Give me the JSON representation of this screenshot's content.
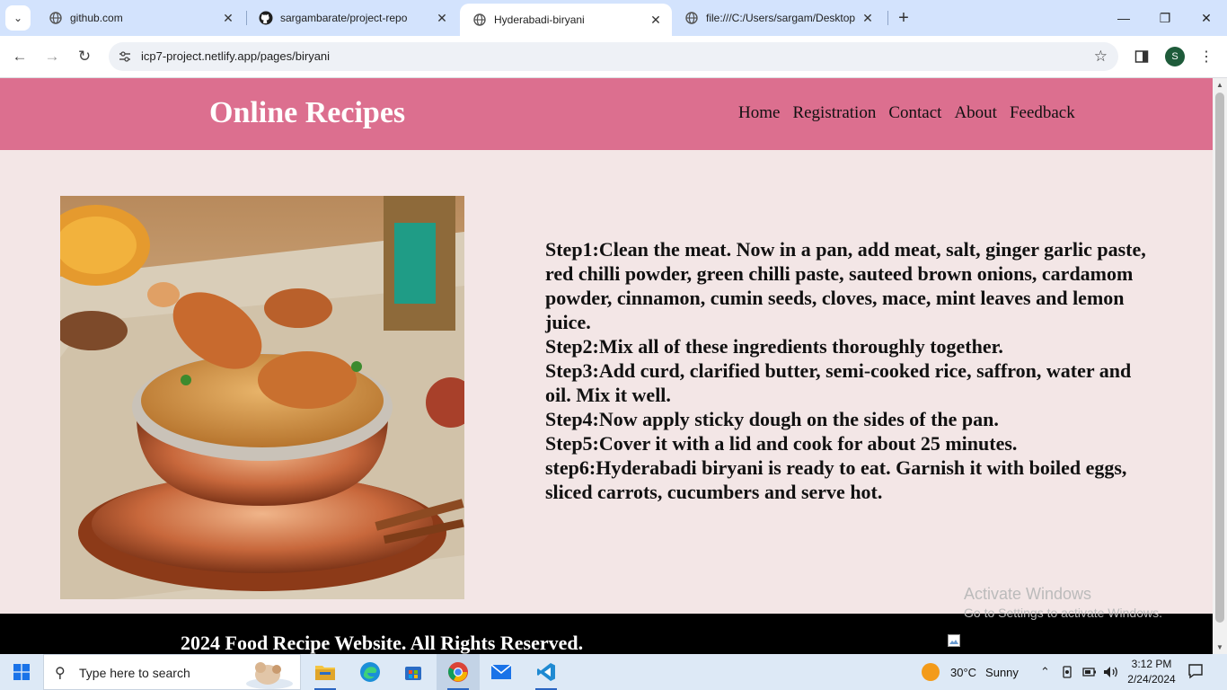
{
  "browser": {
    "tabs": [
      {
        "title": "github.com",
        "icon": "globe-icon",
        "active": false
      },
      {
        "title": "sargambarate/project-repo",
        "icon": "github-icon",
        "active": false
      },
      {
        "title": "Hyderabadi-biryani",
        "icon": "globe-icon",
        "active": true
      },
      {
        "title": "file:///C:/Users/sargam/Desktop",
        "icon": "globe-icon",
        "active": false
      }
    ],
    "url": "icp7-project.netlify.app/pages/biryani",
    "profile_initial": "S"
  },
  "page": {
    "logo": "Online Recipes",
    "nav": [
      "Home",
      "Registration",
      "Contact",
      "About",
      "Feedback"
    ],
    "steps": [
      "Step1:Clean the meat. Now in a pan, add meat, salt, ginger garlic paste,",
      "red chilli powder, green chilli paste, sauteed brown onions, cardamom powder, cinnamon, cumin seeds, cloves, mace, mint leaves and lemon juice.",
      "Step2:Mix all of these ingredients thoroughly together.",
      "Step3:Add curd, clarified butter, semi-cooked rice, saffron, water and oil. Mix it well.",
      "Step4:Now apply sticky dough on the sides of the pan.",
      "Step5:Cover it with a lid and cook for about 25 minutes.",
      "step6:Hyderabadi biryani is ready to eat. Garnish it with boiled eggs, sliced carrots, cucumbers and serve hot."
    ],
    "footer": "2024 Food Recipe Website. All Rights Reserved.",
    "header_color": "#dc6f8f",
    "background_color": "#f3e6e6"
  },
  "watermark": {
    "line1": "Activate Windows",
    "line2": "Go to Settings to activate Windows."
  },
  "taskbar": {
    "search_placeholder": "Type here to search",
    "weather": {
      "temp": "30°C",
      "condition": "Sunny"
    },
    "time": "3:12 PM",
    "date": "2/24/2024"
  }
}
